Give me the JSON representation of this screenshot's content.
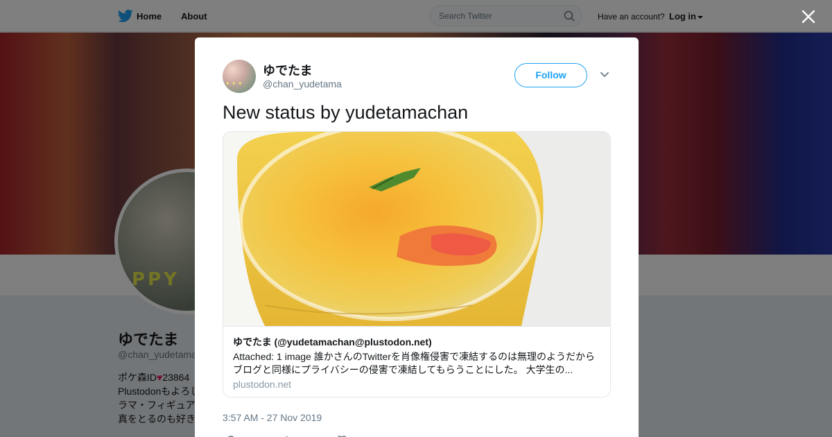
{
  "topbar": {
    "home_label": "Home",
    "about_label": "About",
    "search_placeholder": "Search Twitter",
    "account_prompt": "Have an account?",
    "login_label": "Log in"
  },
  "profile": {
    "name": "ゆでたま",
    "handle": "@chan_yudetama",
    "bio_lines": [
      "ポケ森ID",
      "23864",
      "Plustodonもよろし",
      "ラマ・フィギュア",
      "真をとるのも好き"
    ],
    "avatar_text": "PPY"
  },
  "tweet": {
    "display_name": "ゆでたま",
    "handle": "@chan_yudetama",
    "follow_label": "Follow",
    "text": "New status by yudetamachan",
    "timestamp": "3:57 AM - 27 Nov 2019",
    "reply_count": "",
    "card": {
      "title": "ゆでたま (@yudetamachan@plustodon.net)",
      "description": "Attached: 1 image 誰かさんのTwitterを肖像権侵害で凍結するのは無理のようだから ブログと同様にプライバシーの侵害で凍結してもらうことにした。 大学生の...",
      "domain": "plustodon.net"
    }
  },
  "colors": {
    "accent": "#1da1f2",
    "heart": "#e0245e"
  },
  "icons": [
    "twitter-bird-icon",
    "home-icon",
    "search-icon",
    "caret-down-icon",
    "close-icon",
    "chevron-down-icon",
    "reply-icon",
    "retweet-icon",
    "like-icon",
    "heart-emoji-icon"
  ]
}
